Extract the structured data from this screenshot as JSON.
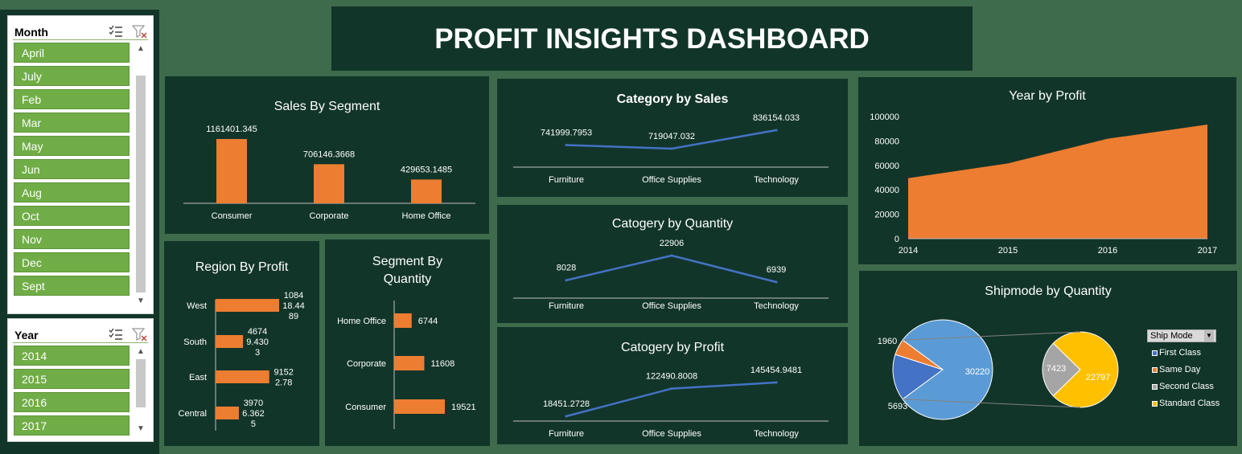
{
  "dashboard_title": "PROFIT INSIGHTS DASHBOARD",
  "colors": {
    "background": "#3e6b4b",
    "panel": "#12352a",
    "bar": "#ed7d31",
    "line": "#4472c4",
    "slicer_item": "#70ad47"
  },
  "month_slicer": {
    "title": "Month",
    "items": [
      "April",
      "July",
      "Feb",
      "Mar",
      "May",
      "Jun",
      "Aug",
      "Oct",
      "Nov",
      "Dec",
      "Sept"
    ]
  },
  "year_slicer": {
    "title": "Year",
    "items": [
      "2014",
      "2015",
      "2016",
      "2017"
    ]
  },
  "sales_by_segment": {
    "title": "Sales By Segment",
    "chart_data": {
      "type": "bar",
      "categories": [
        "Consumer",
        "Corporate",
        "Home Office"
      ],
      "values": [
        1161401.345,
        706146.3668,
        429653.1485
      ],
      "value_labels": [
        "1161401.345",
        "706146.3668",
        "429653.1485"
      ]
    }
  },
  "category_by_sales": {
    "title": "Category by Sales",
    "chart_data": {
      "type": "line",
      "categories": [
        "Furniture",
        "Office Supplies",
        "Technology"
      ],
      "values": [
        741999.7953,
        719047.032,
        836154.033
      ],
      "value_labels": [
        "741999.7953",
        "719047.032",
        "836154.033"
      ]
    }
  },
  "category_by_quantity": {
    "title": "Catogery by Quantity",
    "chart_data": {
      "type": "line",
      "categories": [
        "Furniture",
        "Office Supplies",
        "Technology"
      ],
      "values": [
        8028,
        22906,
        6939
      ],
      "value_labels": [
        "8028",
        "22906",
        "6939"
      ]
    }
  },
  "category_by_profit": {
    "title": "Catogery by Profit",
    "chart_data": {
      "type": "line",
      "categories": [
        "Furniture",
        "Office Supplies",
        "Technology"
      ],
      "values": [
        18451.2728,
        122490.8008,
        145454.9481
      ],
      "value_labels": [
        "18451.2728",
        "122490.8008",
        "145454.9481"
      ]
    }
  },
  "region_by_profit": {
    "title": "Region By Profit",
    "chart_data": {
      "type": "bar",
      "orientation": "horizontal",
      "categories": [
        "West",
        "South",
        "East",
        "Central"
      ],
      "values": [
        108418.4489,
        46749.4303,
        91522.78,
        39706.3625
      ],
      "value_label_lines": [
        [
          "1084",
          "18.44",
          "89"
        ],
        [
          "4674",
          "9.430",
          "3"
        ],
        [
          "9152",
          "2.78"
        ],
        [
          "3970",
          "6.362",
          "5"
        ]
      ]
    }
  },
  "segment_by_quantity": {
    "title_lines": [
      "Segment By",
      "Quantity"
    ],
    "chart_data": {
      "type": "bar",
      "orientation": "horizontal",
      "categories": [
        "Home Office",
        "Corporate",
        "Consumer"
      ],
      "values": [
        6744,
        11608,
        19521
      ],
      "value_labels": [
        "6744",
        "11608",
        "19521"
      ]
    }
  },
  "year_by_profit": {
    "title": "Year by Profit",
    "chart_data": {
      "type": "area",
      "x": [
        "2014",
        "2015",
        "2016",
        "2017"
      ],
      "values": [
        49500,
        61600,
        81800,
        93400
      ],
      "ylim": [
        0,
        100000
      ],
      "y_ticks": [
        "0",
        "20000",
        "40000",
        "60000",
        "80000",
        "100000"
      ]
    }
  },
  "shipmode_by_quantity": {
    "title": "Shipmode by Quantity",
    "legend_title": "Ship Mode",
    "chart_data": {
      "type": "pie",
      "subtype": "pie-of-pie",
      "categories": [
        "First Class",
        "Same Day",
        "Second Class",
        "Standard Class"
      ],
      "values": [
        5693,
        1960,
        7423,
        22797
      ],
      "main_pie_other_total": 30220,
      "value_labels": [
        "5693",
        "1960",
        "7423",
        "22797",
        "30220"
      ],
      "colors": [
        "#4472c4",
        "#ed7d31",
        "#a5a5a5",
        "#ffc000"
      ],
      "other_color": "#5b9bd5"
    }
  }
}
